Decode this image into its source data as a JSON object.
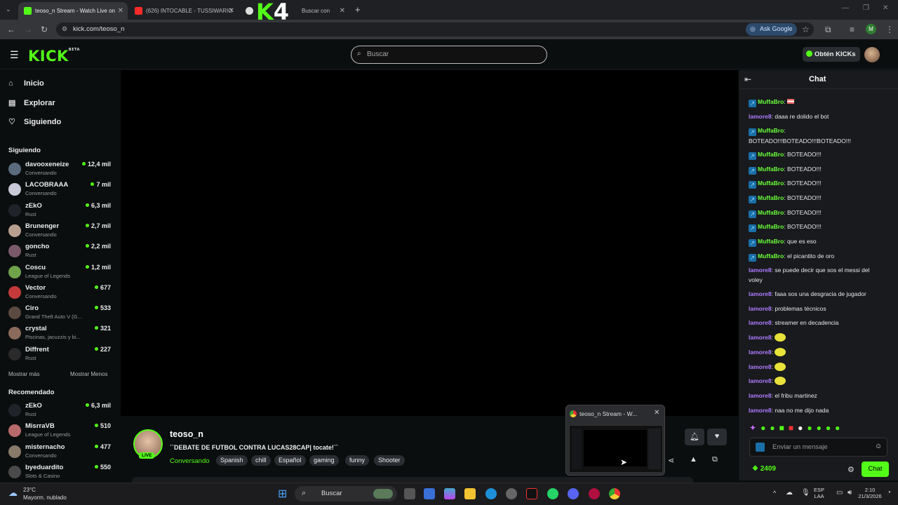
{
  "browser": {
    "tabs": [
      {
        "title": "teoso_n Stream - Watch Live on",
        "active": true
      },
      {
        "title": "(626) INTOCABLE - TUSSIWARIO",
        "active": false
      },
      {
        "title": "Buscar con",
        "active": false
      }
    ],
    "overlay_logo": {
      "k": "K",
      "four": "4"
    },
    "url": "kick.com/teoso_n",
    "ask_google": "Ask Google",
    "profile_initial": "M"
  },
  "header": {
    "logo": "KICK",
    "logo_badge": "BETA",
    "search_placeholder": "Buscar",
    "get_kicks": "Obtén KICKs"
  },
  "sidebar": {
    "nav": [
      {
        "label": "Inicio",
        "icon": "home-icon"
      },
      {
        "label": "Explorar",
        "icon": "compass-icon"
      },
      {
        "label": "Siguiendo",
        "icon": "heart-icon"
      }
    ],
    "following_title": "Siguiendo",
    "following": [
      {
        "name": "davooxeneize",
        "game": "Conversando",
        "viewers": "12,4 mil",
        "color": "#5a6b7d"
      },
      {
        "name": "LACOBRAAA",
        "game": "Conversando",
        "viewers": "7 mil",
        "color": "#c9c9d8"
      },
      {
        "name": "zEkO",
        "game": "Rust",
        "viewers": "6,3 mil",
        "color": "#20242a"
      },
      {
        "name": "Brunenger",
        "game": "Conversando",
        "viewers": "2,7 mil",
        "color": "#b7a090"
      },
      {
        "name": "goncho",
        "game": "Rust",
        "viewers": "2,2 mil",
        "color": "#7a5a6a"
      },
      {
        "name": "Coscu",
        "game": "League of Legends",
        "viewers": "1,2 mil",
        "color": "#6fa24a"
      },
      {
        "name": "Vector",
        "game": "Conversando",
        "viewers": "677",
        "color": "#c43a3a"
      },
      {
        "name": "Ciro",
        "game": "Grand Theft Auto V (G...",
        "viewers": "533",
        "color": "#5a4a40"
      },
      {
        "name": "crystal",
        "game": "Piscinas, jacuzzis y bi...",
        "viewers": "321",
        "color": "#8a6a5a"
      },
      {
        "name": "Diffrent",
        "game": "Rust",
        "viewers": "227",
        "color": "#2a2a2a"
      }
    ],
    "show_more": "Mostrar más",
    "show_less": "Mostrar Menos",
    "recommended_title": "Recomendado",
    "recommended": [
      {
        "name": "zEkO",
        "game": "Rust",
        "viewers": "6,3 mil",
        "color": "#20242a"
      },
      {
        "name": "MisrraVB",
        "game": "League of Legends",
        "viewers": "510",
        "color": "#b86a6a"
      },
      {
        "name": "misternacho",
        "game": "Conversando",
        "viewers": "477",
        "color": "#8a7a6a"
      },
      {
        "name": "byeduardito",
        "game": "Slots & Casino",
        "viewers": "550",
        "color": "#4a4a4a"
      }
    ]
  },
  "stream": {
    "channel": "teoso_n",
    "live_label": "LIVE",
    "title": "``DEBATE DE FUTBOL CONTRA LUCAS28CAP| tocate!``",
    "category": "Conversando",
    "tags": [
      "Spanish",
      "chill",
      "Español",
      "gaming",
      "funny",
      "Shooter"
    ]
  },
  "popup": {
    "title": "teoso_n Stream - W..."
  },
  "chat": {
    "title": "Chat",
    "messages": [
      {
        "user": "MuffaBro",
        "badge": true,
        "text": "",
        "flag": true,
        "color": "#6bff3a"
      },
      {
        "user": "lamore8",
        "badge": false,
        "text": "daaa re dolido el bot",
        "color": "#b07bff"
      },
      {
        "user": "MuffaBro",
        "badge": true,
        "text": "BOTEADO!!!BOTEADO!!!BOTEADO!!!",
        "color": "#6bff3a"
      },
      {
        "user": "MuffaBro",
        "badge": true,
        "text": "BOTEADO!!!",
        "color": "#6bff3a"
      },
      {
        "user": "MuffaBro",
        "badge": true,
        "text": "BOTEADO!!!",
        "color": "#6bff3a"
      },
      {
        "user": "MuffaBro",
        "badge": true,
        "text": "BOTEADO!!!",
        "color": "#6bff3a"
      },
      {
        "user": "MuffaBro",
        "badge": true,
        "text": "BOTEADO!!!",
        "color": "#6bff3a"
      },
      {
        "user": "MuffaBro",
        "badge": true,
        "text": "BOTEADO!!!",
        "color": "#6bff3a"
      },
      {
        "user": "MuffaBro",
        "badge": true,
        "text": "BOTEADO!!!",
        "color": "#6bff3a"
      },
      {
        "user": "MuffaBro",
        "badge": true,
        "text": "que es eso",
        "color": "#6bff3a"
      },
      {
        "user": "MuffaBro",
        "badge": true,
        "text": "el picantito de oro",
        "color": "#6bff3a"
      },
      {
        "user": "lamore8",
        "badge": false,
        "text": "se puede decir que sos el messi del voley",
        "color": "#b07bff"
      },
      {
        "user": "lamore8",
        "badge": false,
        "text": "faaa sos una desgracia de jugador",
        "color": "#b07bff"
      },
      {
        "user": "lamore8",
        "badge": false,
        "text": "problemas técnicos",
        "color": "#b07bff"
      },
      {
        "user": "lamore8",
        "badge": false,
        "text": "streamer en decadencia",
        "color": "#b07bff"
      },
      {
        "user": "lamore8",
        "badge": false,
        "text": "",
        "emote": true,
        "color": "#b07bff"
      },
      {
        "user": "lamore8",
        "badge": false,
        "text": "",
        "emote": true,
        "color": "#b07bff"
      },
      {
        "user": "lamore8",
        "badge": false,
        "text": "",
        "emote": true,
        "color": "#b07bff"
      },
      {
        "user": "lamore8",
        "badge": false,
        "text": "",
        "emote": true,
        "color": "#b07bff"
      },
      {
        "user": "lamore8",
        "badge": false,
        "text": "el fribu martinez",
        "color": "#b07bff"
      },
      {
        "user": "lamore8",
        "badge": false,
        "text": "naa no me dijo nada",
        "color": "#b07bff"
      }
    ],
    "input_placeholder": "Enviar un mensaje",
    "points": "2409",
    "send_label": "Chat"
  },
  "taskbar": {
    "weather_temp": "23°C",
    "weather_desc": "Mayorm. nublado",
    "search_label": "Buscar",
    "lang_top": "ESP",
    "lang_bottom": "LAA",
    "time": "2:10",
    "date": "21/3/2026"
  }
}
